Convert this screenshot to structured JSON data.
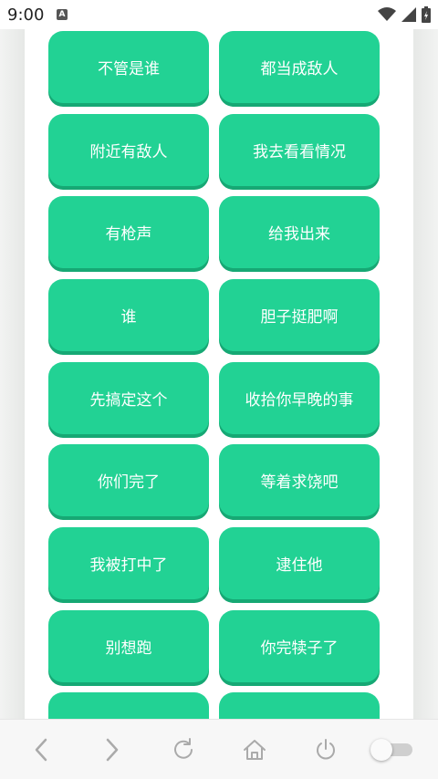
{
  "status_bar": {
    "time": "9:00",
    "notification_letter": "A",
    "icons": [
      "wifi-icon",
      "signal-icon",
      "battery-icon"
    ]
  },
  "buttons": [
    "不管是谁",
    "都当成敌人",
    "附近有敌人",
    "我去看看情况",
    "有枪声",
    "给我出来",
    "谁",
    "胆子挺肥啊",
    "先搞定这个",
    "收拾你早晚的事",
    "你们完了",
    "等着求饶吧",
    "我被打中了",
    "逮住他",
    "别想跑",
    "你完犊子了",
    "",
    ""
  ],
  "nav_bar": {
    "items": [
      "back-icon",
      "forward-icon",
      "refresh-icon",
      "home-icon",
      "power-icon"
    ],
    "toggle_on": false
  },
  "colors": {
    "button": "#22d294",
    "button_shadow": "#16a874",
    "button_text": "#ffffff"
  }
}
